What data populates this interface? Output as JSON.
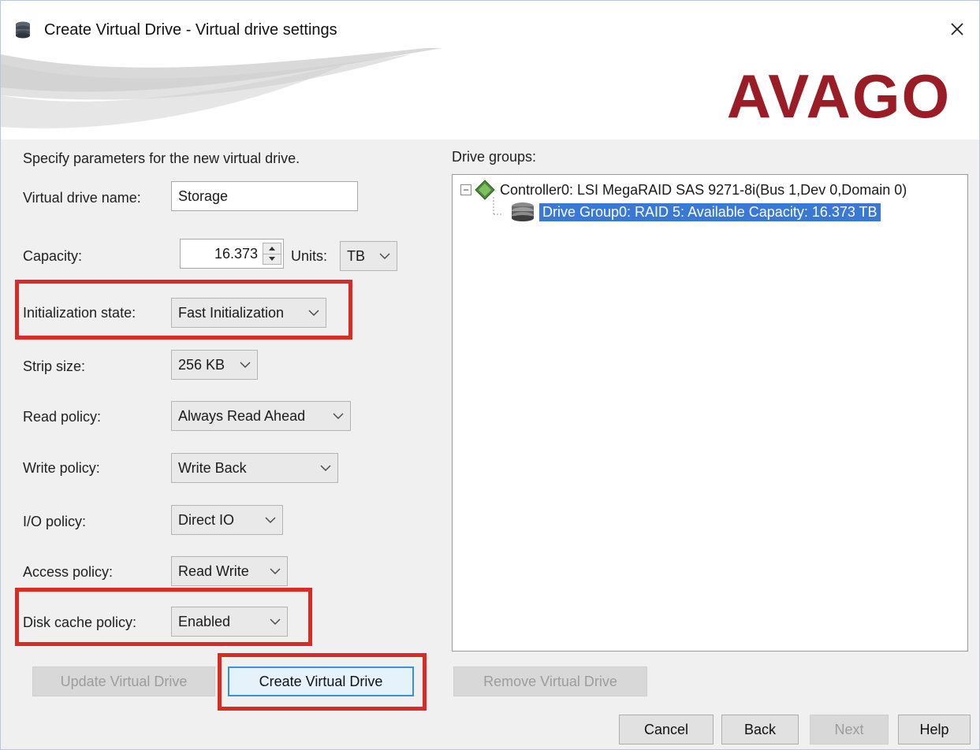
{
  "window": {
    "title": "Create Virtual Drive - Virtual drive settings",
    "close_symbol": "✕",
    "brand": "AVAGO",
    "brand_color": "#9a1c27"
  },
  "form": {
    "intro": "Specify parameters for the new virtual drive.",
    "vd_name_label": "Virtual drive name:",
    "vd_name_value": "Storage",
    "capacity_label": "Capacity:",
    "capacity_value": "16.373",
    "units_label": "Units:",
    "units_value": "TB",
    "init_label": "Initialization state:",
    "init_value": "Fast Initialization",
    "strip_label": "Strip size:",
    "strip_value": "256 KB",
    "read_label": "Read policy:",
    "read_value": "Always Read Ahead",
    "write_label": "Write policy:",
    "write_value": "Write Back",
    "io_label": "I/O policy:",
    "io_value": "Direct IO",
    "access_label": "Access policy:",
    "access_value": "Read Write",
    "disk_cache_label": "Disk cache policy:",
    "disk_cache_value": "Enabled"
  },
  "buttons": {
    "update": "Update Virtual Drive",
    "create": "Create Virtual Drive",
    "remove": "Remove Virtual Drive",
    "cancel": "Cancel",
    "back": "Back",
    "next": "Next",
    "help": "Help"
  },
  "drive_groups": {
    "title": "Drive groups:",
    "controller": "Controller0: LSI MegaRAID SAS 9271-8i(Bus 1,Dev 0,Domain 0)",
    "group": "Drive Group0: RAID  5: Available Capacity: 16.373 TB",
    "selection_color": "#3a78d6"
  },
  "icons": {
    "title": "database-icon",
    "controller": "diamond-controller-icon",
    "group": "drive-stack-icon"
  },
  "highlight_color": "#d92b23"
}
